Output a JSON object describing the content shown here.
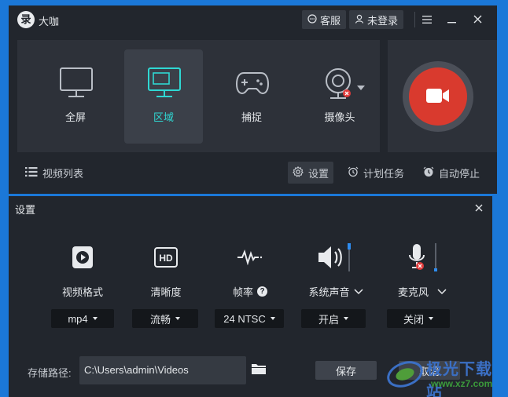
{
  "colors": {
    "desktop": "#1b78d8",
    "window_bg": "#22262d",
    "panel_bg": "#2d3139",
    "accent_cyan": "#2fd8d3",
    "record_red": "#d93a2e",
    "mic_off_red": "#e23b3b",
    "level_blue": "#2e8cf0"
  },
  "app": {
    "logo_char": "录",
    "title": "大咖"
  },
  "titlebar": {
    "service_label": "客服",
    "service_icon": "chat-bubble-icon",
    "login_label": "未登录",
    "login_icon": "user-icon",
    "menu_icon": "hamburger-icon",
    "minimize_icon": "minimize-icon",
    "close_icon": "close-icon"
  },
  "modes": [
    {
      "label": "全屏",
      "icon": "monitor-icon",
      "active": false
    },
    {
      "label": "区域",
      "icon": "monitor-region-icon",
      "active": true
    },
    {
      "label": "捕捉",
      "icon": "gamepad-icon",
      "active": false
    },
    {
      "label": "摄像头",
      "icon": "webcam-icon",
      "active": false
    }
  ],
  "record": {
    "icon": "video-camera-icon"
  },
  "bottombar": {
    "video_list": "视频列表",
    "settings": "设置",
    "schedule": "计划任务",
    "auto_stop": "自动停止"
  },
  "settings": {
    "title": "设置",
    "options": [
      {
        "label": "视频格式",
        "icon": "video-format-icon",
        "value": "mp4"
      },
      {
        "label": "清晰度",
        "icon": "hd-icon",
        "value": "流畅"
      },
      {
        "label": "帧率",
        "icon": "waveform-icon",
        "value": "24 NTSC",
        "help": "?"
      },
      {
        "label": "系统声音",
        "icon": "speaker-icon",
        "value": "开启",
        "level": 0.35
      },
      {
        "label": "麦克风",
        "icon": "microphone-off-icon",
        "value": "关闭",
        "level": 0.05
      }
    ],
    "storage_label": "存储路径:",
    "storage_path": "C:\\Users\\admin\\Videos",
    "save_label": "保存",
    "cancel_label": "取消"
  },
  "watermark": {
    "site_name": "极光下载站",
    "site_url": "www.xz7.com"
  }
}
